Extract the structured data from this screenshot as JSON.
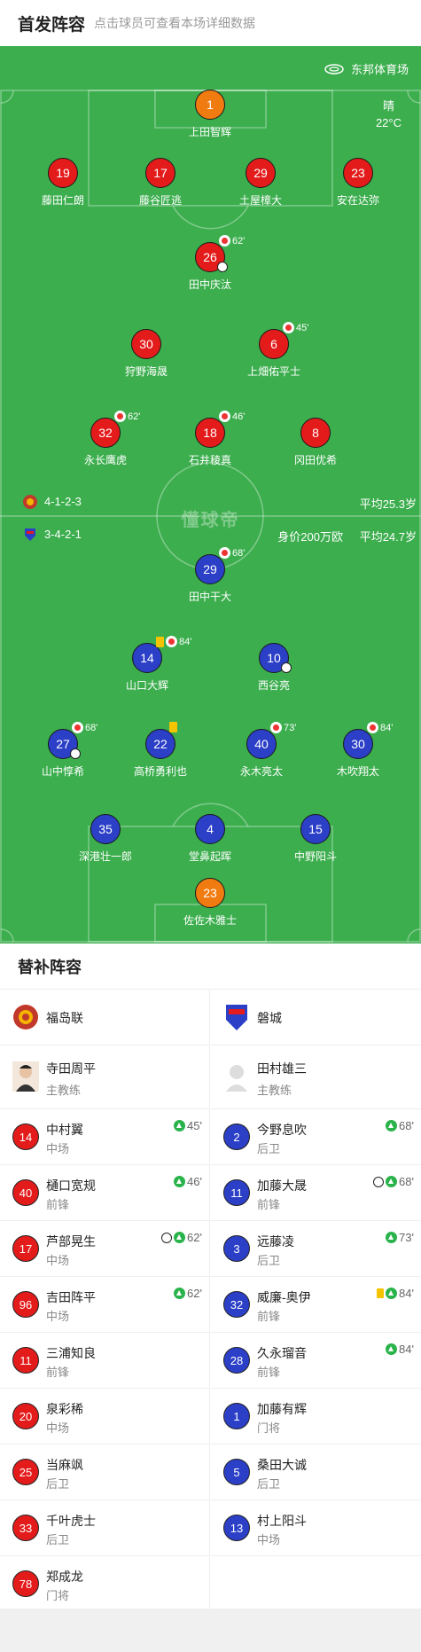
{
  "header": {
    "title": "首发阵容",
    "subtitle": "点击球员可查看本场详细数据"
  },
  "pitch": {
    "stadium": "东邦体育场",
    "weather": "晴",
    "temperature": "22°C",
    "watermark": "懂球帝"
  },
  "home": {
    "formation": "4-1-2-3",
    "avg_age": "平均25.3岁",
    "color": "#e41b1b"
  },
  "away": {
    "formation": "3-4-2-1",
    "value": "身价200万欧",
    "avg_age": "平均24.7岁",
    "color": "#2b3fc7"
  },
  "home_players": [
    {
      "num": "1",
      "name": "上田智辉",
      "gk": true
    },
    {
      "num": "19",
      "name": "藤田仁朗"
    },
    {
      "num": "17",
      "name": "藤谷匠逃"
    },
    {
      "num": "29",
      "name": "土屋樟大"
    },
    {
      "num": "23",
      "name": "安在达弥"
    },
    {
      "num": "26",
      "name": "田中庆汰",
      "sub": "62'",
      "ball": true
    },
    {
      "num": "30",
      "name": "狩野海晟"
    },
    {
      "num": "6",
      "name": "上畑佑平士",
      "sub": "45'"
    },
    {
      "num": "32",
      "name": "永长鹰虎",
      "sub": "62'"
    },
    {
      "num": "18",
      "name": "石井稜真",
      "sub": "46'"
    },
    {
      "num": "8",
      "name": "冈田优希"
    }
  ],
  "away_players": [
    {
      "num": "29",
      "name": "田中干大",
      "sub": "68'"
    },
    {
      "num": "14",
      "name": "山口大辉",
      "sub": "84'",
      "yellow": true
    },
    {
      "num": "10",
      "name": "西谷亮",
      "ball": true
    },
    {
      "num": "27",
      "name": "山中惇希",
      "sub": "68'",
      "ball": true
    },
    {
      "num": "22",
      "name": "高桥勇利也",
      "yellow": true
    },
    {
      "num": "40",
      "name": "永木亮太",
      "sub": "73'"
    },
    {
      "num": "30",
      "name": "木吹翔太",
      "sub": "84'"
    },
    {
      "num": "35",
      "name": "深港壮一郎"
    },
    {
      "num": "4",
      "name": "堂鼻起晖"
    },
    {
      "num": "15",
      "name": "中野阳斗"
    },
    {
      "num": "23",
      "name": "佐佐木雅士",
      "gk": true
    }
  ],
  "subs": {
    "title": "替补阵容",
    "home_team": "福岛联",
    "away_team": "磐城",
    "home_coach": {
      "name": "寺田周平",
      "role": "主教练"
    },
    "away_coach": {
      "name": "田村雄三",
      "role": "主教练"
    },
    "home": [
      {
        "num": "14",
        "name": "中村翼",
        "pos": "中场",
        "time": "45'"
      },
      {
        "num": "40",
        "name": "樋口宽规",
        "pos": "前锋",
        "time": "46'"
      },
      {
        "num": "17",
        "name": "芦部晃生",
        "pos": "中场",
        "time": "62'",
        "ball": true
      },
      {
        "num": "96",
        "name": "吉田阵平",
        "pos": "中场",
        "time": "62'"
      },
      {
        "num": "11",
        "name": "三浦知良",
        "pos": "前锋"
      },
      {
        "num": "20",
        "name": "泉彩稀",
        "pos": "中场"
      },
      {
        "num": "25",
        "name": "当麻飒",
        "pos": "后卫"
      },
      {
        "num": "33",
        "name": "千叶虎士",
        "pos": "后卫"
      },
      {
        "num": "78",
        "name": "郑成龙",
        "pos": "门将"
      }
    ],
    "away": [
      {
        "num": "2",
        "name": "今野息吹",
        "pos": "后卫",
        "time": "68'"
      },
      {
        "num": "11",
        "name": "加藤大晟",
        "pos": "前锋",
        "time": "68'",
        "ball": true
      },
      {
        "num": "3",
        "name": "远藤凌",
        "pos": "后卫",
        "time": "73'"
      },
      {
        "num": "32",
        "name": "威廉-奥伊",
        "pos": "前锋",
        "time": "84'",
        "yellow": true
      },
      {
        "num": "28",
        "name": "久永瑠音",
        "pos": "前锋",
        "time": "84'"
      },
      {
        "num": "1",
        "name": "加藤有辉",
        "pos": "门将"
      },
      {
        "num": "5",
        "name": "桑田大诚",
        "pos": "后卫"
      },
      {
        "num": "13",
        "name": "村上阳斗",
        "pos": "中场"
      }
    ]
  }
}
